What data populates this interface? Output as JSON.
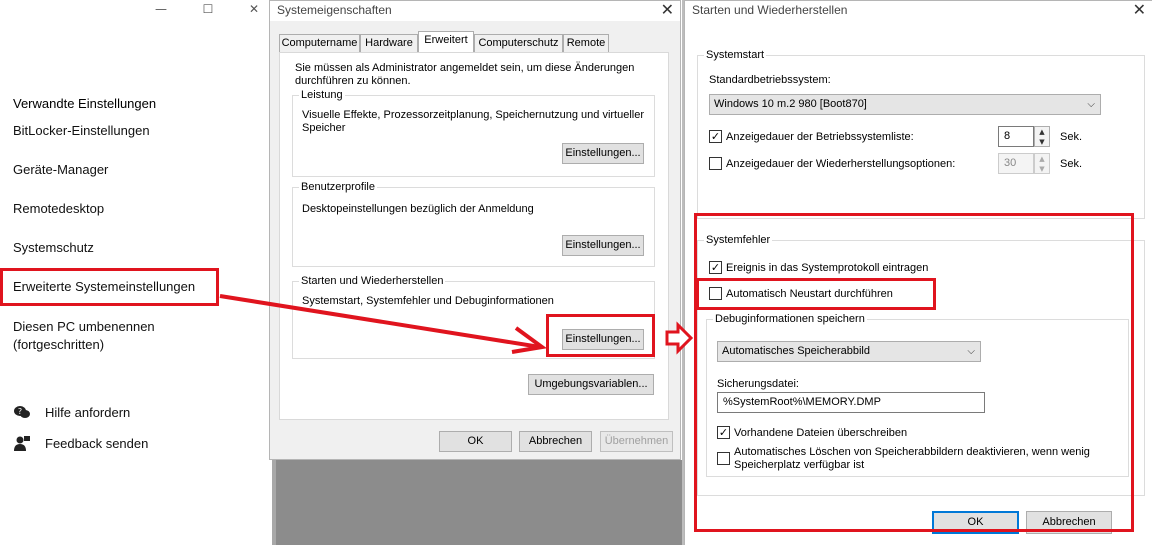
{
  "left_pane": {
    "controls": {
      "minimize": "—",
      "maximize": "☐",
      "close": "✕"
    },
    "heading": "Verwandte Einstellungen",
    "links": [
      "BitLocker-Einstellungen",
      "Geräte-Manager",
      "Remotedesktop",
      "Systemschutz",
      "Erweiterte Systemeinstellungen",
      "Diesen PC umbenennen (fortgeschritten)"
    ],
    "help": "Hilfe anfordern",
    "feedback": "Feedback senden"
  },
  "sysprops": {
    "title": "Systemeigenschaften",
    "close": "✕",
    "tabs": [
      "Computername",
      "Hardware",
      "Erweitert",
      "Computerschutz",
      "Remote"
    ],
    "admin_note": "Sie müssen als Administrator angemeldet sein, um diese Änderungen durchführen zu können.",
    "performance": {
      "label": "Leistung",
      "text": "Visuelle Effekte, Prozessorzeitplanung, Speichernutzung und virtueller Speicher",
      "button": "Einstellungen..."
    },
    "profiles": {
      "label": "Benutzerprofile",
      "text": "Desktopeinstellungen bezüglich der Anmeldung",
      "button": "Einstellungen..."
    },
    "startup": {
      "label": "Starten und Wiederherstellen",
      "text": "Systemstart, Systemfehler und Debuginformationen",
      "button": "Einstellungen..."
    },
    "env_button": "Umgebungsvariablen...",
    "ok": "OK",
    "cancel": "Abbrechen",
    "apply": "Übernehmen"
  },
  "startup_dialog": {
    "title": "Starten und Wiederherstellen",
    "close": "✕",
    "systemstart": {
      "label": "Systemstart",
      "default_os_label": "Standardbetriebssystem:",
      "default_os": "Windows 10 m.2 980 [Boot870]",
      "os_list_label": "Anzeigedauer der Betriebssystemliste:",
      "os_list_checked": true,
      "os_list_value": "8",
      "recovery_label": "Anzeigedauer der Wiederherstellungsoptionen:",
      "recovery_checked": false,
      "recovery_value": "30",
      "unit": "Sek."
    },
    "systemfehler": {
      "label": "Systemfehler",
      "log_event": "Ereignis in das Systemprotokoll eintragen",
      "log_event_checked": true,
      "auto_restart": "Automatisch Neustart durchführen",
      "auto_restart_checked": false,
      "debug_label": "Debuginformationen speichern",
      "debug_type": "Automatisches Speicherabbild",
      "dump_file_label": "Sicherungsdatei:",
      "dump_file": "%SystemRoot%\\MEMORY.DMP",
      "overwrite": "Vorhandene Dateien überschreiben",
      "overwrite_checked": true,
      "disable_auto_delete": "Automatisches Löschen von Speicherabbildern deaktivieren, wenn wenig Speicherplatz verfügbar ist",
      "disable_auto_delete_checked": false
    },
    "ok": "OK",
    "cancel": "Abbrechen"
  },
  "check_glyph": "✓",
  "colors": {
    "annotation_red": "#e0141e",
    "focus_blue": "#0078d7"
  }
}
